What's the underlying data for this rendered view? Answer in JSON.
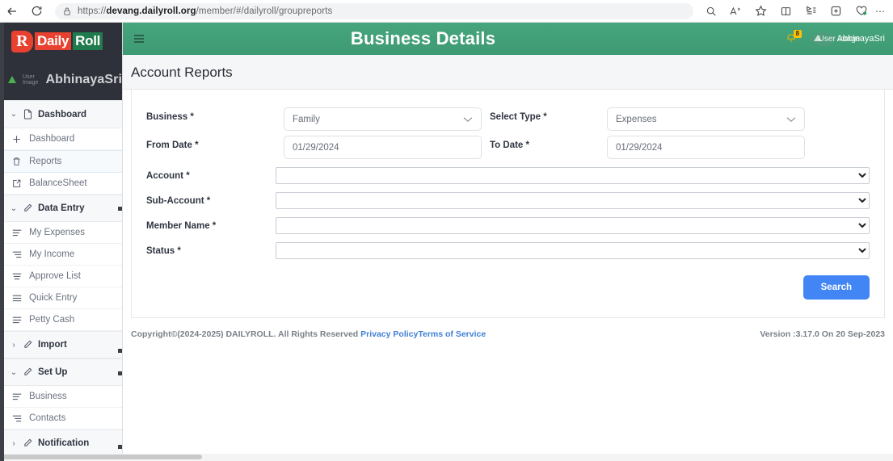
{
  "browser": {
    "url_prefix": "https://",
    "url_domain": "devang.dailyroll.org",
    "url_path": "/member/#/dailyroll/groupreports",
    "back_icon": "back-arrow-icon",
    "reload_icon": "reload-icon",
    "lock_icon": "lock-icon",
    "toolbar_icons": [
      "search-icon",
      "read-aloud-icon",
      "favorite-star-icon",
      "split-screen-icon",
      "collections-icon",
      "browser-essentials-icon",
      "extensions-icon",
      "more-options-icon"
    ],
    "more_dots": "⋯"
  },
  "sidebar": {
    "logo": {
      "mark": "R",
      "part1": "Daily",
      "part2": "Roll"
    },
    "user_name": "AbhinayaSri",
    "broken_image_alt": "User Image",
    "groups": [
      {
        "label": "Dashboard",
        "icon": "file-icon",
        "expanded": true,
        "chevron": "⌄",
        "items": [
          {
            "label": "Dashboard",
            "icon": "plus-icon",
            "active": false
          },
          {
            "label": "Reports",
            "icon": "trash-icon",
            "active": true
          },
          {
            "label": "BalanceSheet",
            "icon": "external-link-icon",
            "active": false
          }
        ]
      },
      {
        "label": "Data Entry",
        "icon": "pencil-icon",
        "expanded": true,
        "chevron": "⌄",
        "items": [
          {
            "label": "My Expenses",
            "icon": "list-icon",
            "active": false
          },
          {
            "label": "My Income",
            "icon": "list-icon",
            "active": false
          },
          {
            "label": "Approve List",
            "icon": "list-icon",
            "active": false
          },
          {
            "label": "Quick Entry",
            "icon": "list-icon",
            "active": false
          },
          {
            "label": "Petty Cash",
            "icon": "list-icon",
            "active": false
          }
        ]
      },
      {
        "label": "Import",
        "icon": "pencil-icon",
        "expanded": false,
        "chevron": "›",
        "items": []
      },
      {
        "label": "Set Up",
        "icon": "pencil-icon",
        "expanded": true,
        "chevron": "⌄",
        "items": [
          {
            "label": "Business",
            "icon": "list-icon",
            "active": false
          },
          {
            "label": "Contacts",
            "icon": "list-icon",
            "active": false
          }
        ]
      },
      {
        "label": "Notification",
        "icon": "pencil-icon",
        "expanded": false,
        "chevron": "›",
        "items": []
      }
    ]
  },
  "topbar": {
    "menu_toggle_icon": "hamburger-icon",
    "title": "Business Details",
    "bell_icon": "bell-icon",
    "bell_badge": "8",
    "avatar_alt": "User Image",
    "user_name": "AbhinayaSri",
    "bg_color": "#429b76"
  },
  "page": {
    "heading": "Account Reports"
  },
  "form": {
    "business": {
      "label": "Business *",
      "value": "Family"
    },
    "select_type": {
      "label": "Select Type *",
      "value": "Expenses"
    },
    "from_date": {
      "label": "From Date *",
      "value": "01/29/2024"
    },
    "to_date": {
      "label": "To Date *",
      "value": "01/29/2024"
    },
    "account": {
      "label": "Account *",
      "value": ""
    },
    "sub_account": {
      "label": "Sub-Account *",
      "value": ""
    },
    "member_name": {
      "label": "Member Name *",
      "value": ""
    },
    "status": {
      "label": "Status *",
      "value": ""
    },
    "search_label": "Search",
    "search_color": "#4285f4",
    "dropdown_icon": "chevron-down-icon"
  },
  "footer": {
    "copyright": "Copyright©(2024-2025) DAILYROLL. All Rights Reserved ",
    "privacy_policy": "Privacy Policy",
    "terms_of_service": "Terms of Service",
    "version": "Version :3.17.0 On 20 Sep-2023"
  }
}
